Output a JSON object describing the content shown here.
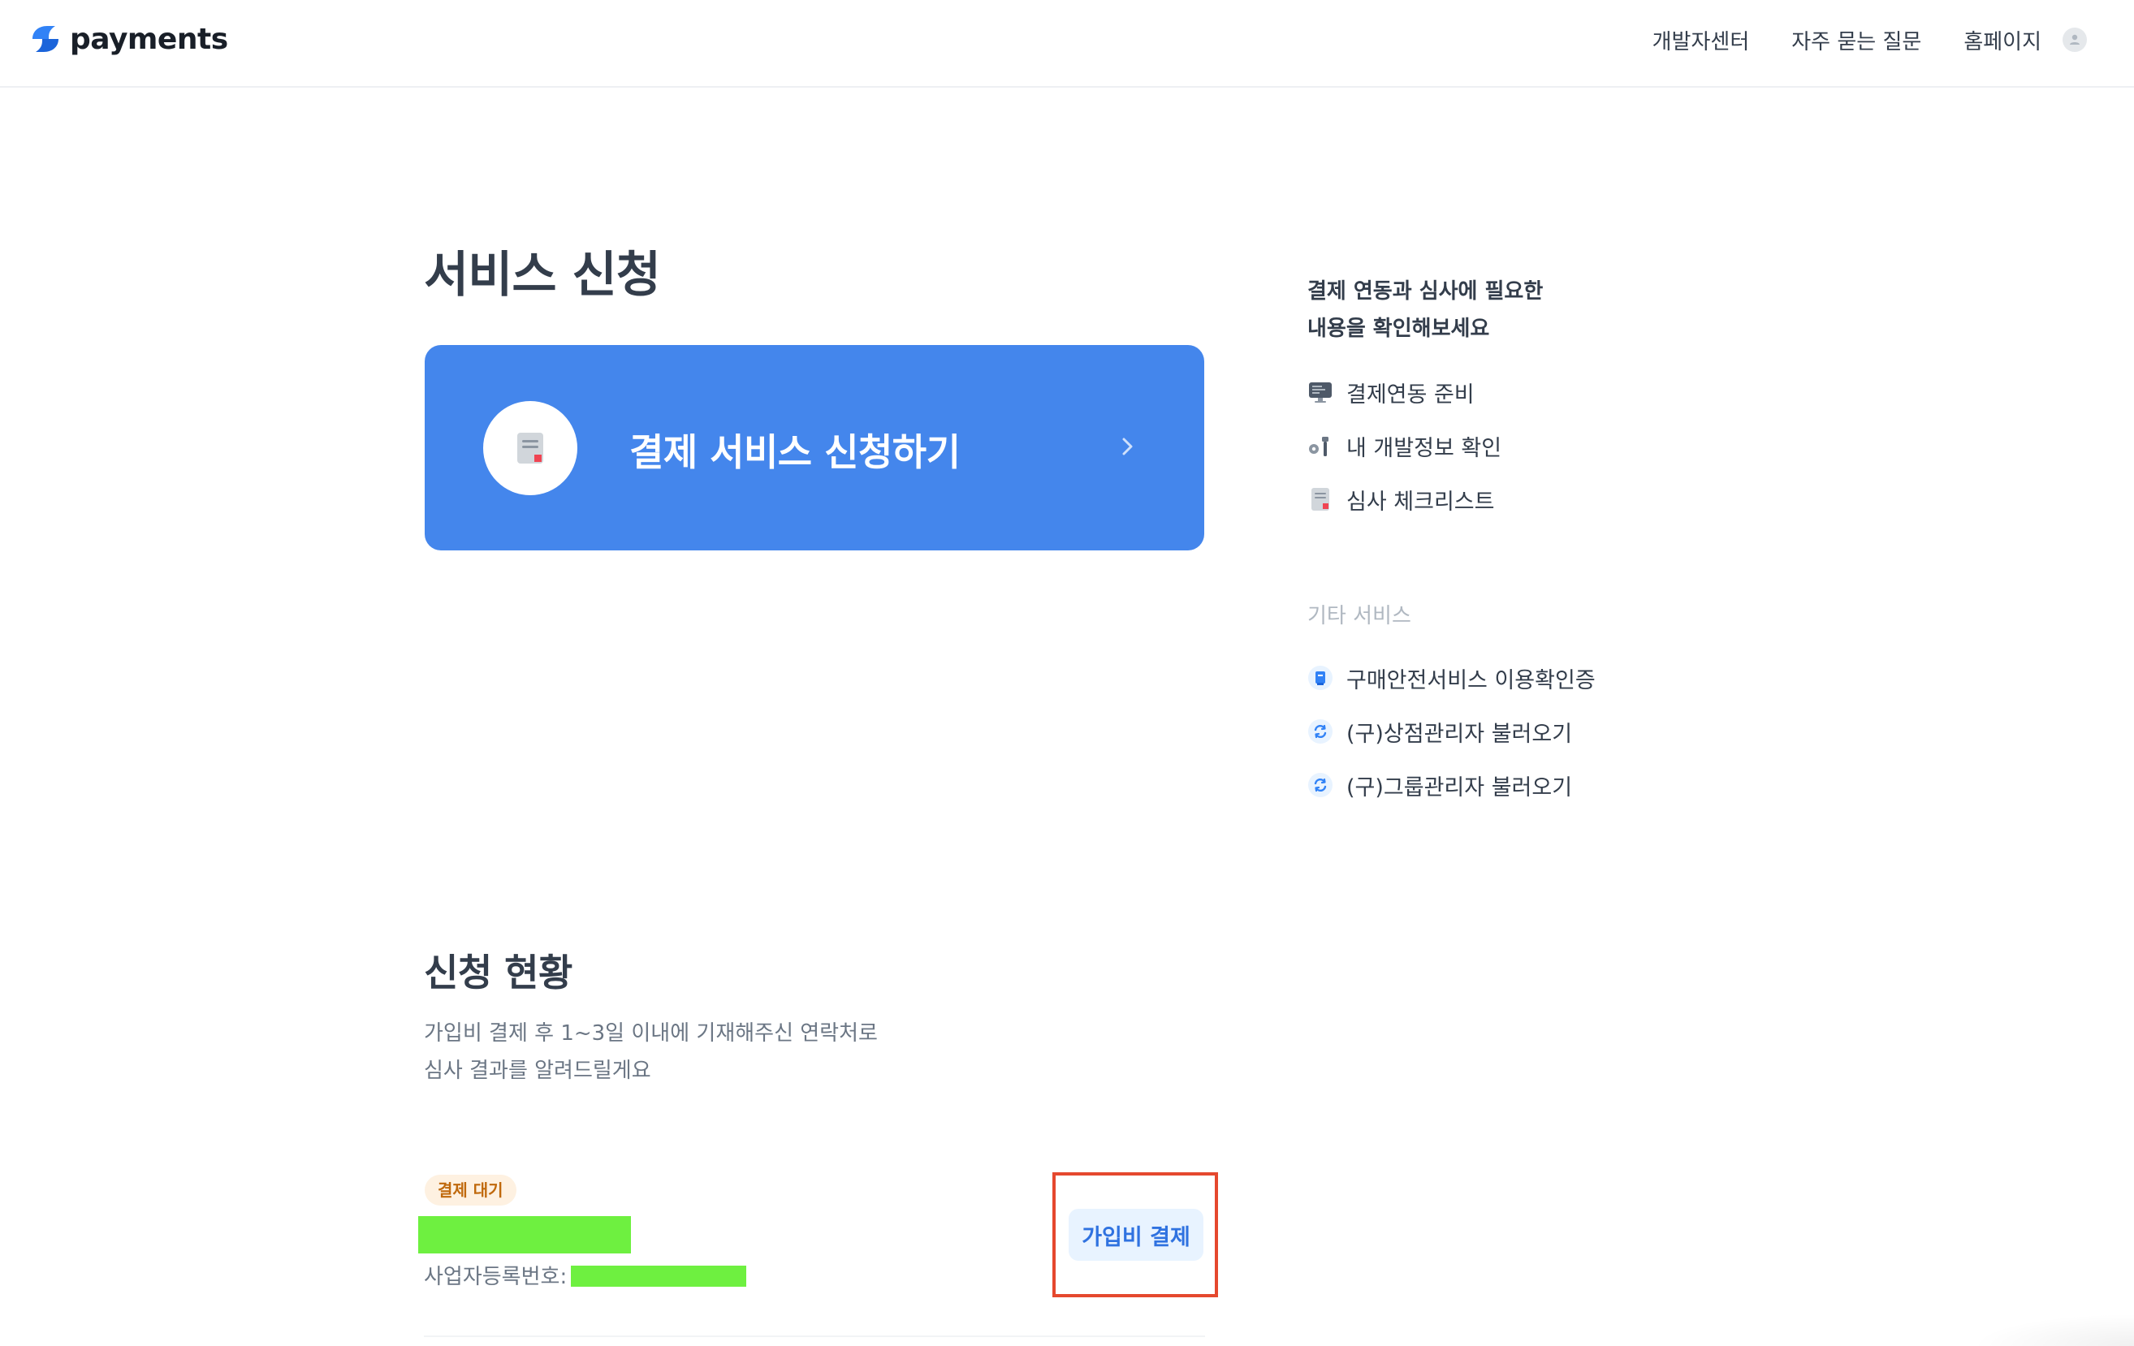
{
  "header": {
    "logo_text": "payments",
    "nav": [
      "개발자센터",
      "자주 묻는 질문",
      "홈페이지"
    ]
  },
  "main": {
    "title": "서비스 신청",
    "apply_card": {
      "label": "결제 서비스 신청하기",
      "icon": "document-icon",
      "color": "#4486ec"
    },
    "status_section": {
      "title": "신청 현황",
      "desc_line1": "가입비 결제 후 1~3일 이내에 기재해주신 연락처로",
      "desc_line2": "심사 결과를 알려드릴게요",
      "badge": "결제 대기",
      "biz_no_label": "사업자등록번호:",
      "pay_button": "가입비 결제"
    }
  },
  "sidebar": {
    "heading_line1": "결제 연동과 심사에 필요한",
    "heading_line2": "내용을 확인해보세요",
    "items": [
      {
        "label": "결제연동 준비",
        "icon": "monitor-icon"
      },
      {
        "label": "내 개발정보 확인",
        "icon": "developer-tools-icon"
      },
      {
        "label": "심사 체크리스트",
        "icon": "document-icon"
      }
    ],
    "other_label": "기타 서비스",
    "other_items": [
      {
        "label": "구매안전서비스 이용확인증",
        "icon": "certificate-icon"
      },
      {
        "label": "(구)상점관리자 불러오기",
        "icon": "refresh-icon"
      },
      {
        "label": "(구)그룹관리자 불러오기",
        "icon": "refresh-icon"
      }
    ]
  },
  "colors": {
    "accent": "#4486ec",
    "badge_bg": "#fef1e1",
    "badge_text": "#c0690c",
    "highlight": "#e5482e",
    "redaction": "#6ef040"
  }
}
